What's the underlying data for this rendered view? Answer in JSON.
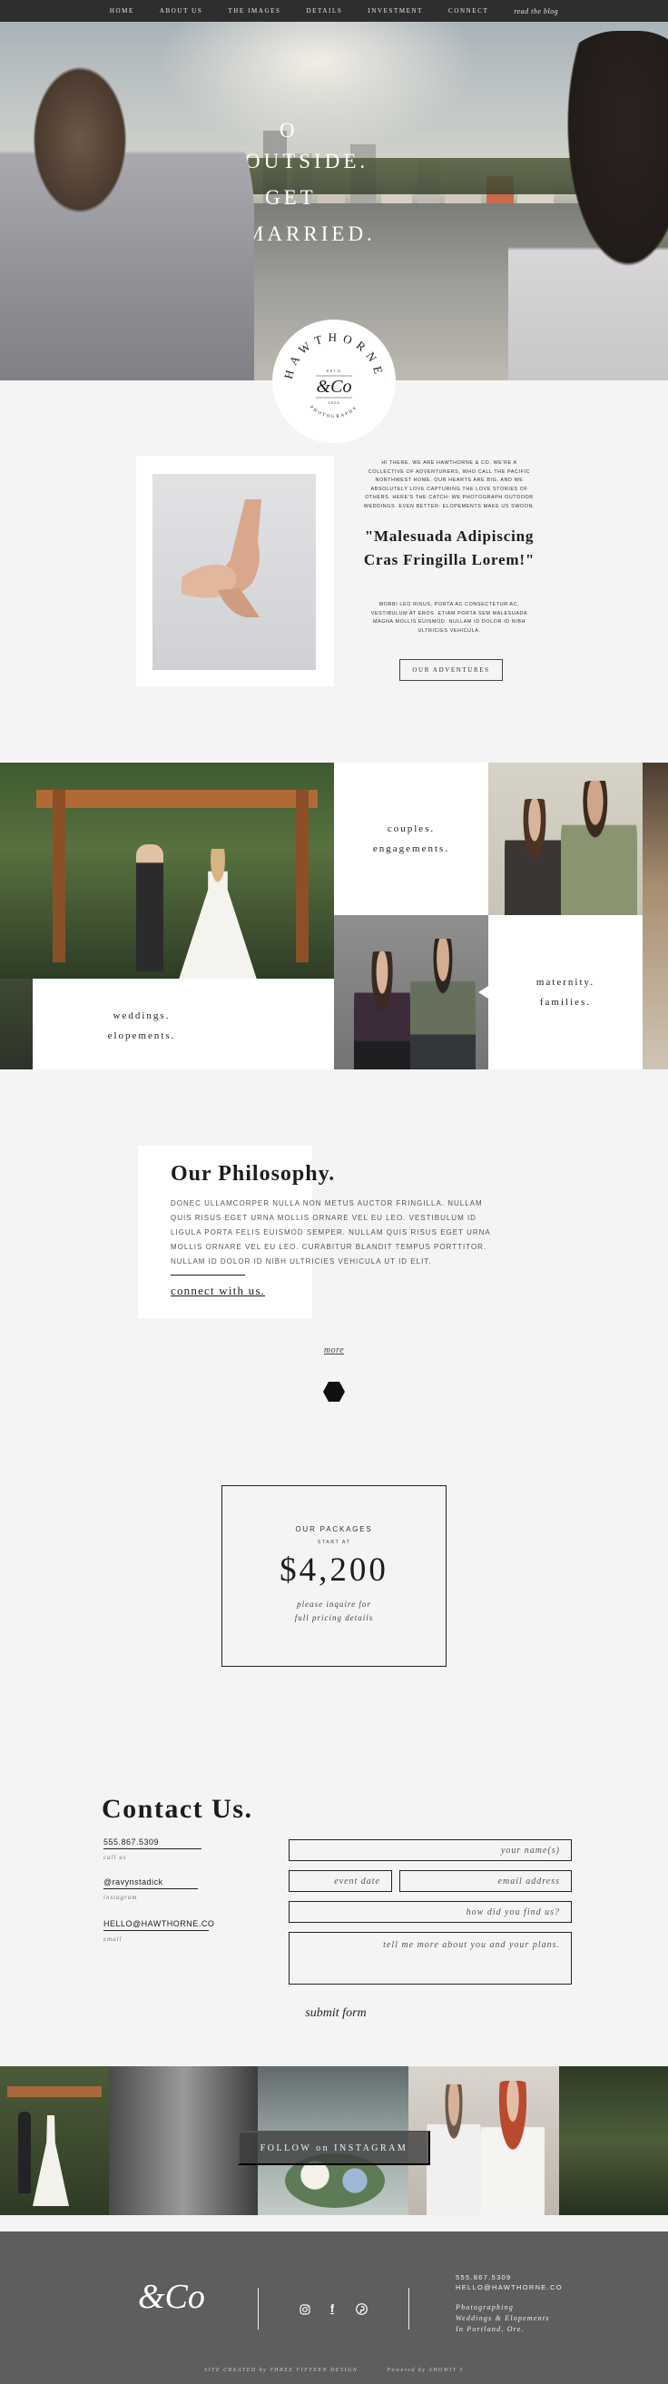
{
  "nav": {
    "items": [
      "HOME",
      "ABOUT US",
      "THE IMAGES",
      "DETAILS",
      "INVESTMENT",
      "CONNECT"
    ],
    "script_link": "read the blog"
  },
  "hero": {
    "line1": "O",
    "line2": "OUTSIDE.",
    "line3": "GET",
    "line4": "MARRIED."
  },
  "badge": {
    "name": "HAWTHORNE",
    "monogram": "&Co",
    "est": "EST'D",
    "year": "2020",
    "sub": "PHOTOGRAPHY"
  },
  "intro": {
    "paragraph": "HI THERE. WE ARE HAWTHORNE & CO. WE'RE A COLLECTIVE OF ADVENTURERS, WHO CALL THE PACIFIC NORTHWEST HOME. OUR HEARTS ARE BIG, AND WE ABSOLUTELY LOVE CAPTURING THE LOVE STORIES OF OTHERS. HERE'S THE CATCH: WE PHOTOGRAPH OUTDOOR WEDDINGS. EVEN BETTER: ELOPEMENTS MAKE US SWOON.",
    "quote": "\"Malesuada Adipiscing Cras Fringilla Lorem!\"",
    "paragraph2": "MORBI LEO RISUS, PORTA AC CONSECTETUR AC, VESTIBULUM AT EROS. ETIAM PORTA SEM MALESUADA MAGNA MOLLIS EUISMOD. NULLAM ID DOLOR ID NIBH ULTRICIES VEHICULA.",
    "button": "OUR ADVENTURES"
  },
  "gallery": {
    "weddings_line1": "weddings.",
    "weddings_line2": "elopements.",
    "couples_line1": "couples.",
    "couples_line2": "engagements.",
    "maternity_line1": "maternity.",
    "maternity_line2": "families."
  },
  "philosophy": {
    "title": "Our Philosophy.",
    "body": "DONEC ULLAMCORPER NULLA NON METUS AUCTOR FRINGILLA. NULLAM QUIS RISUS EGET URNA MOLLIS ORNARE VEL EU LEO. VESTIBULUM ID LIGULA PORTA FELIS EUISMOD SEMPER. NULLAM QUIS RISUS EGET URNA MOLLIS ORNARE VEL EU LEO. CURABITUR BLANDIT TEMPUS PORTTITOR. NULLAM ID DOLOR ID NIBH ULTRICIES VEHICULA UT ID ELIT.",
    "link": "connect with us.",
    "more": "more"
  },
  "packages": {
    "label": "OUR PACKAGES",
    "start": "START AT",
    "price": "$4,200",
    "note_line1": "please inquire for",
    "note_line2": "full pricing details"
  },
  "contact": {
    "title": "Contact Us.",
    "phone": "555.867.5309",
    "phone_label": "call us",
    "handle": "@ravynstadick",
    "handle_label": "instagram",
    "email": "HELLO@HAWTHORNE.CO",
    "email_label": "email",
    "placeholders": {
      "name": "your name(s)",
      "date": "event date",
      "email": "email address",
      "found": "how did you find us?",
      "message": "tell me more about you and your plans."
    },
    "submit": "submit form"
  },
  "instagram": {
    "button": "FOLLOW on INSTAGRAM"
  },
  "footer": {
    "logo": "&Co",
    "phone": "555.867.5309",
    "email": "HELLO@HAWTHORNE.CO",
    "tag1": "Photographing",
    "tag2": "Weddings & Elopements",
    "tag3": "In Portland, Ore.",
    "credit_left": "SITE CREATED by THREE FIFTEEN DESIGN",
    "credit_right": "Powered by SHOWIT 5"
  },
  "colors": {
    "nav_bg": "#2e2e2e",
    "page_bg": "#f4f4f4",
    "footer_bg": "#5e5e5e",
    "ink": "#1c1c1c"
  },
  "icons": [
    "instagram-icon",
    "facebook-icon",
    "pinterest-icon"
  ]
}
